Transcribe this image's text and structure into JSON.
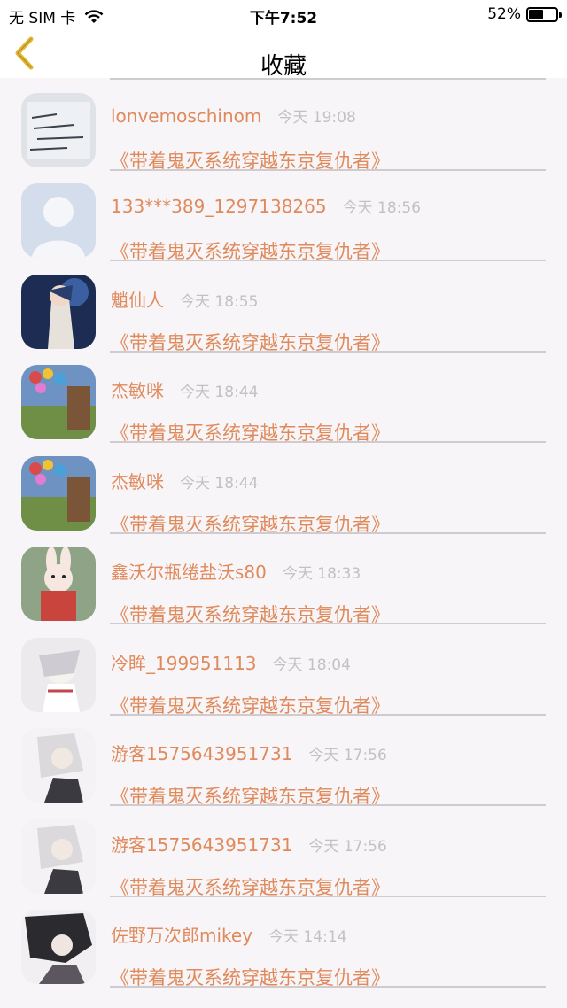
{
  "status_bar": {
    "carrier": "无 SIM 卡",
    "time": "下午7:52",
    "battery_percent": "52%",
    "battery_level": 0.52
  },
  "nav": {
    "title": "收藏",
    "back_icon": "chevron-left-icon"
  },
  "colors": {
    "accent": "#e08a5c",
    "back_arrow": "#e3b632",
    "timestamp": "#c2c2c2",
    "divider": "#cfcbcf",
    "background": "#f7f5f7"
  },
  "items": [
    {
      "user": "",
      "time": "",
      "novel": "《带着鬼灭系统穿越东京复仇者》",
      "avatar": "avatar-purple"
    },
    {
      "user": "lonvemoschinom",
      "time": "今天 19:08",
      "novel": "《带着鬼灭系统穿越东京复仇者》",
      "avatar": "avatar-handwriting"
    },
    {
      "user": "133***389_1297138265",
      "time": "今天 18:56",
      "novel": "《带着鬼灭系统穿越东京复仇者》",
      "avatar": "avatar-default"
    },
    {
      "user": "魈仙人",
      "time": "今天 18:55",
      "novel": "《带着鬼灭系统穿越东京复仇者》",
      "avatar": "avatar-anime-dark"
    },
    {
      "user": "杰敏咪",
      "time": "今天 18:44",
      "novel": "《带着鬼灭系统穿越东京复仇者》",
      "avatar": "avatar-balloons"
    },
    {
      "user": "杰敏咪",
      "time": "今天 18:44",
      "novel": "《带着鬼灭系统穿越东京复仇者》",
      "avatar": "avatar-balloons"
    },
    {
      "user": "鑫沃尔瓶绻盐沃s80",
      "time": "今天 18:33",
      "novel": "《带着鬼灭系统穿越东京复仇者》",
      "avatar": "avatar-bunny"
    },
    {
      "user": "冷眸_199951113",
      "time": "今天 18:04",
      "novel": "《带着鬼灭系统穿越东京复仇者》",
      "avatar": "avatar-anime-white"
    },
    {
      "user": "游客1575643951731",
      "time": "今天 17:56",
      "novel": "《带着鬼灭系统穿越东京复仇者》",
      "avatar": "avatar-anime-light"
    },
    {
      "user": "游客1575643951731",
      "time": "今天 17:56",
      "novel": "《带着鬼灭系统穿越东京复仇者》",
      "avatar": "avatar-anime-light"
    },
    {
      "user": "佐野万次郎mikey",
      "time": "今天 14:14",
      "novel": "《带着鬼灭系统穿越东京复仇者》",
      "avatar": "avatar-anime-ink"
    }
  ]
}
